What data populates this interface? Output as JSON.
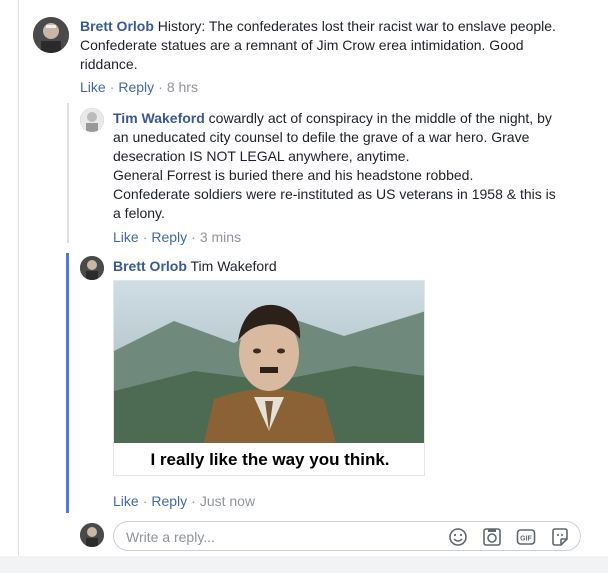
{
  "comments": [
    {
      "author": "Brett Orlob",
      "text_line1": " History: The confederates lost their racist war to enslave people.",
      "text_line2": "Confederate statues are a remnant of Jim Crow erea intimidation. Good",
      "text_line3": "riddance.",
      "like_label": "Like",
      "reply_label": "Reply",
      "time": "8 hrs"
    },
    {
      "author": "Tim Wakeford",
      "text_line1": " cowardly act of conspiracy in the middle of the night, by",
      "text_line2": "an uneducated city counsel to defile the grave of a war hero. Grave",
      "text_line3": "desecration IS NOT LEGAL anywhere, anytime.",
      "text_line4": "General Forrest is buried there and his headstone robbed.",
      "text_line5": "Confederate soldiers were re-instituted as US veterans in 1958 & this is",
      "text_line6": "a felony.",
      "like_label": "Like",
      "reply_label": "Reply",
      "time": "3 mins"
    },
    {
      "author": "Brett Orlob",
      "mention": " Tim Wakeford",
      "image_caption": "I really like the way you think.",
      "like_label": "Like",
      "reply_label": "Reply",
      "time": "Just now"
    }
  ],
  "reply_box": {
    "placeholder": "Write a reply...",
    "icons": [
      "emoji-icon",
      "camera-icon",
      "gif-icon",
      "sticker-icon"
    ],
    "icon_gif_text": "GIF"
  },
  "colors": {
    "link": "#385898",
    "action": "#4267b2",
    "meta": "#90949c",
    "thread_active": "#4f7bd6"
  }
}
